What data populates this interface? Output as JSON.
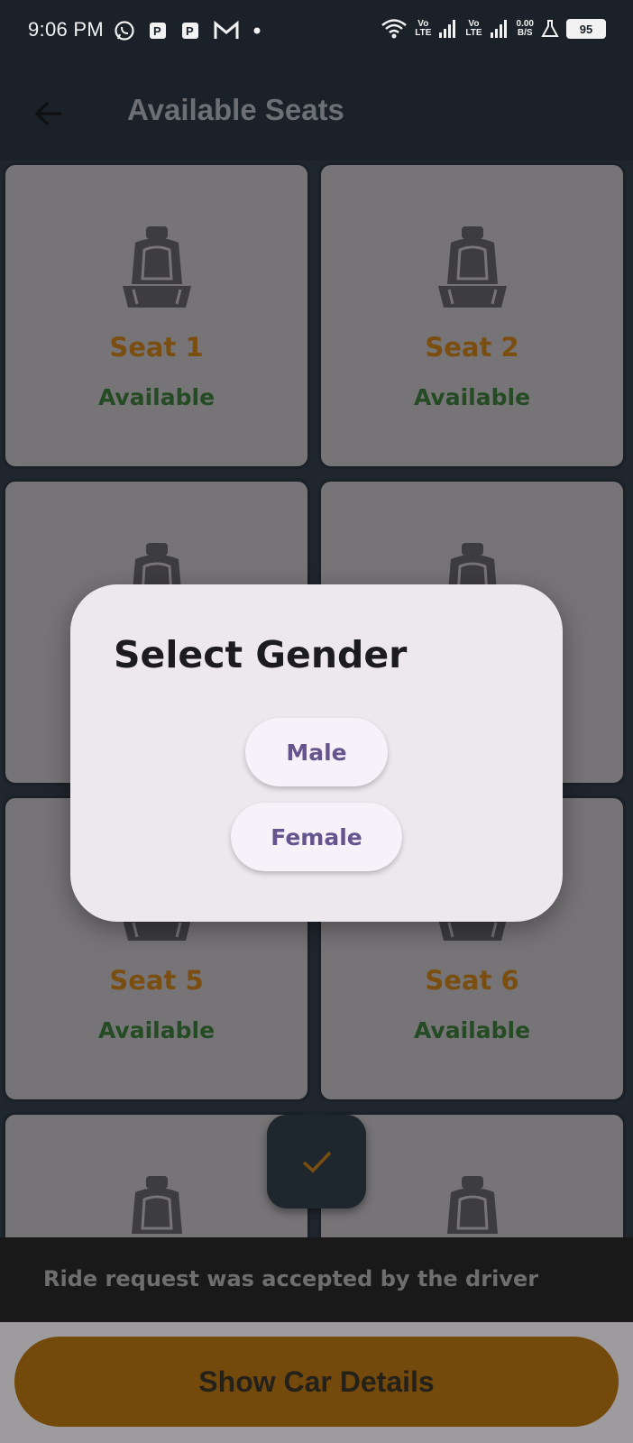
{
  "status_bar": {
    "time": "9:06 PM",
    "battery": "95",
    "net_speed_top": "0.00",
    "net_speed_bottom": "B/S",
    "lte1_top": "Vo",
    "lte1_bottom": "LTE",
    "lte2_top": "Vo",
    "lte2_bottom": "LTE"
  },
  "app_bar": {
    "title": "Available Seats"
  },
  "seats": [
    {
      "name": "Seat 1",
      "status": "Available"
    },
    {
      "name": "Seat 2",
      "status": "Available"
    },
    {
      "name": "Seat 5",
      "status": "Available"
    },
    {
      "name": "Seat 6",
      "status": "Available"
    }
  ],
  "snackbar": {
    "message": "Ride request was accepted by the driver"
  },
  "bottom": {
    "show_car_label": "Show Car Details"
  },
  "dialog": {
    "title": "Select Gender",
    "options": [
      "Male",
      "Female"
    ]
  },
  "colors": {
    "app_bar_bg": "#1a2128",
    "seat_card_bg": "#767477",
    "seat_name": "#7a4e10",
    "seat_status": "#244b24",
    "primary_button": "#744a0c",
    "dialog_bg": "#ede8ee",
    "dialog_button_text": "#65558f"
  }
}
